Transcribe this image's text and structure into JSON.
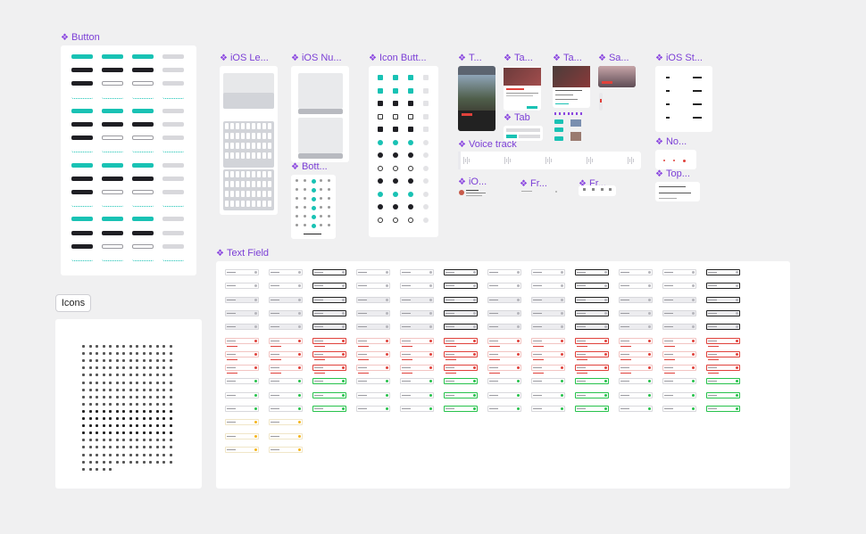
{
  "canvas": {
    "background": "#f0f0f1"
  },
  "frames": {
    "button": "Button",
    "ios_le": "iOS Le...",
    "ios_nu": "iOS Nu...",
    "icon_butt": "Icon Butt...",
    "t": "T...",
    "ta1": "Ta...",
    "ta2": "Ta...",
    "sa": "Sa...",
    "ios_st": "iOS St...",
    "tab": "Tab",
    "voice_track": "Voice track",
    "no": "No...",
    "bott": "Bott...",
    "io": "iO...",
    "fr1": "Fr...",
    "fr2": "Fr...",
    "top": "Top...",
    "text_field": "Text Field"
  },
  "icons_label": "Icons",
  "colors": {
    "accent": "#19c2b4",
    "frame_label": "#7b3fd6",
    "error": "#e0413b",
    "success": "#27c24c",
    "warning": "#f5b51b"
  },
  "icon_name": "component-icon"
}
